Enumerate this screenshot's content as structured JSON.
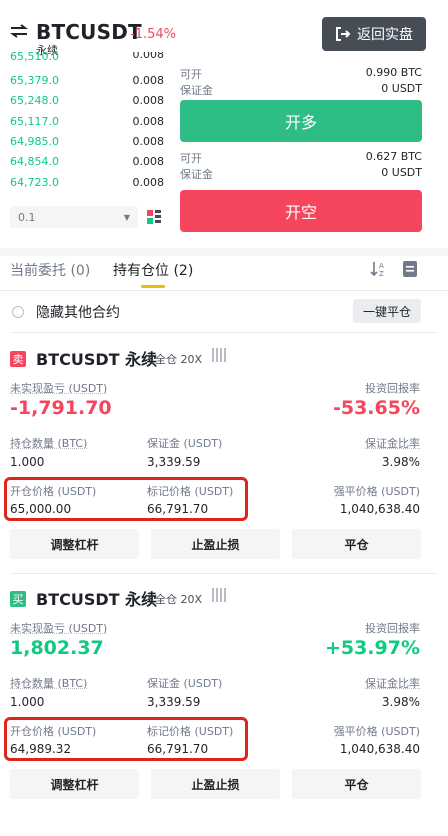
{
  "header": {
    "symbol": "BTCUSDT",
    "change": "-1.54%",
    "contract_type": "永续",
    "back_button": "返回实盘"
  },
  "order_book": {
    "cut_row": {
      "price": "65,510.0",
      "qty": "0.008"
    },
    "rows": [
      {
        "price": "65,379.0",
        "qty": "0.008"
      },
      {
        "price": "65,248.0",
        "qty": "0.008"
      },
      {
        "price": "65,117.0",
        "qty": "0.008"
      },
      {
        "price": "64,985.0",
        "qty": "0.008"
      },
      {
        "price": "64,854.0",
        "qty": "0.008"
      },
      {
        "price": "64,723.0",
        "qty": "0.008"
      }
    ],
    "depth_value": "0.1"
  },
  "order_panel": {
    "long": {
      "available_label": "可开",
      "available_value": "0.990 BTC",
      "margin_label": "保证金",
      "margin_value": "0 USDT",
      "button": "开多"
    },
    "short": {
      "available_label": "可开",
      "available_value": "0.627 BTC",
      "margin_label": "保证金",
      "margin_value": "0 USDT",
      "button": "开空"
    }
  },
  "tabs": {
    "open_orders": "当前委托 (0)",
    "positions": "持有仓位 (2)"
  },
  "filter": {
    "hide_label": "隐藏其他合约",
    "close_all": "一键平仓"
  },
  "labels": {
    "unrealized_pnl": "未实现盈亏 (USDT)",
    "roe": "投资回报率",
    "size": "持仓数量 (BTC)",
    "margin": "保证金 (USDT)",
    "margin_ratio": "保证金比率",
    "entry_price": "开仓价格 (USDT)",
    "mark_price": "标记价格 (USDT)",
    "liq_price": "强平价格 (USDT)",
    "adjust_leverage": "调整杠杆",
    "tp_sl": "止盈止损",
    "close": "平仓"
  },
  "positions": [
    {
      "side": "卖",
      "side_color": "#f6465d",
      "title": "BTCUSDT 永续",
      "mode": "全仓 20X",
      "pnl": "-1,791.70",
      "roe": "-53.65%",
      "size": "1.000",
      "margin": "3,339.59",
      "margin_ratio": "3.98%",
      "entry_price": "65,000.00",
      "mark_price": "66,791.70",
      "liq_price": "1,040,638.40"
    },
    {
      "side": "买",
      "side_color": "#2ebd85",
      "title": "BTCUSDT 永续",
      "mode": "全仓 20X",
      "pnl": "1,802.37",
      "roe": "+53.97%",
      "size": "1.000",
      "margin": "3,339.59",
      "margin_ratio": "3.98%",
      "entry_price": "64,989.32",
      "mark_price": "66,791.70",
      "liq_price": "1,040,638.40"
    }
  ],
  "colors": {
    "green": "#0ecb81",
    "red": "#f6465d",
    "yellow": "#f0b90b",
    "highlight": "#e0241b"
  }
}
